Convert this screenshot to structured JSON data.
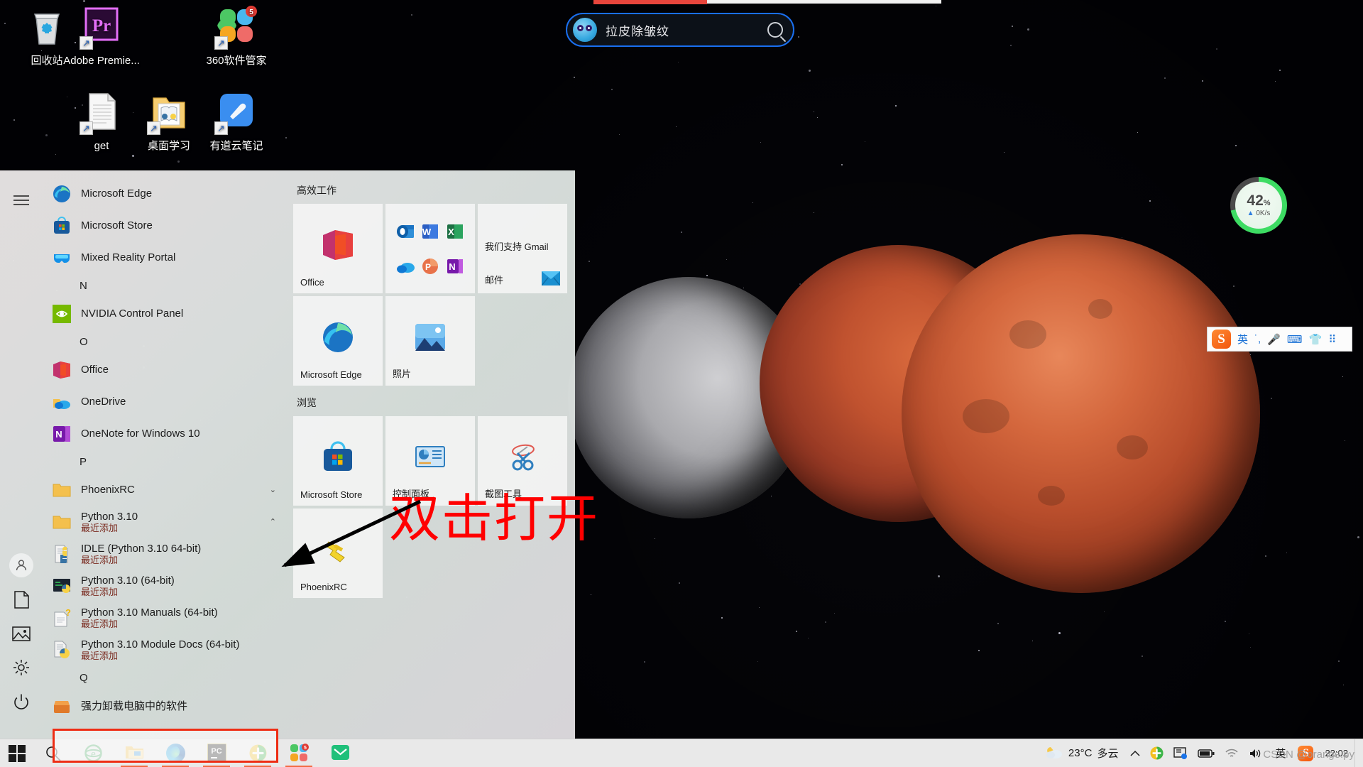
{
  "desktop": {
    "icons": [
      {
        "label": "回收站",
        "icon": "recycle-bin-icon",
        "shortcut": false
      },
      {
        "label": "Adobe Premie...",
        "icon": "adobe-premiere-icon",
        "shortcut": true
      },
      {
        "label": "360软件管家",
        "icon": "360-software-manager-icon",
        "shortcut": true,
        "badge": "5"
      },
      {
        "label": "get",
        "icon": "text-document-icon",
        "shortcut": true
      },
      {
        "label": "桌面学习",
        "icon": "folder-study-icon",
        "shortcut": true
      },
      {
        "label": "有道云笔记",
        "icon": "youdao-cloud-note-icon",
        "shortcut": true
      }
    ]
  },
  "search_overlay": {
    "value": "拉皮除皱纹",
    "icon": "bird-mascot-icon",
    "search_icon": "search-icon"
  },
  "perf_gauge": {
    "percent": "42",
    "percent_unit": "%",
    "network": "0K/s",
    "arrow": "▲",
    "accent": "#3ddc63"
  },
  "sogou_bar": {
    "logo": "S",
    "items": [
      "英",
      "·,",
      "mic-icon",
      "keyboard-icon",
      "skin-icon",
      "apps-icon"
    ]
  },
  "start_menu": {
    "rail": [
      {
        "name": "hamburger-icon",
        "label": "☰"
      },
      {
        "name": "user-account-icon",
        "label": ""
      },
      {
        "name": "documents-icon",
        "label": ""
      },
      {
        "name": "pictures-icon",
        "label": ""
      },
      {
        "name": "settings-gear-icon",
        "label": ""
      },
      {
        "name": "power-icon",
        "label": ""
      }
    ],
    "apps": [
      {
        "type": "app",
        "label": "Microsoft Edge",
        "icon": "edge-icon"
      },
      {
        "type": "app",
        "label": "Microsoft Store",
        "icon": "store-icon"
      },
      {
        "type": "app",
        "label": "Mixed Reality Portal",
        "icon": "mixed-reality-icon"
      },
      {
        "type": "letter",
        "label": "N"
      },
      {
        "type": "app",
        "label": "NVIDIA Control Panel",
        "icon": "nvidia-icon"
      },
      {
        "type": "letter",
        "label": "O"
      },
      {
        "type": "app",
        "label": "Office",
        "icon": "office-icon"
      },
      {
        "type": "app",
        "label": "OneDrive",
        "icon": "onedrive-icon"
      },
      {
        "type": "app",
        "label": "OneNote for Windows 10",
        "icon": "onenote-icon"
      },
      {
        "type": "letter",
        "label": "P"
      },
      {
        "type": "folder",
        "label": "PhoenixRC",
        "icon": "folder-icon",
        "chevron": "⌄"
      },
      {
        "type": "folder",
        "label": "Python 3.10",
        "sub": "最近添加",
        "icon": "folder-icon",
        "chevron": "⌃"
      },
      {
        "type": "app",
        "label": "IDLE (Python 3.10 64-bit)",
        "sub": "最近添加",
        "icon": "python-idle-icon",
        "highlighted": true
      },
      {
        "type": "app",
        "label": "Python 3.10 (64-bit)",
        "sub": "最近添加",
        "icon": "python-console-icon"
      },
      {
        "type": "app",
        "label": "Python 3.10 Manuals (64-bit)",
        "sub": "最近添加",
        "icon": "python-manuals-icon"
      },
      {
        "type": "app",
        "label": "Python 3.10 Module Docs (64-bit)",
        "sub": "最近添加",
        "icon": "python-moduledocs-icon"
      },
      {
        "type": "letter",
        "label": "Q"
      },
      {
        "type": "app",
        "label": "强力卸载电脑中的软件",
        "icon": "uninstall-tool-icon"
      }
    ],
    "tile_groups": [
      {
        "title": "高效工作",
        "tiles": [
          {
            "label": "Office",
            "icon": "office-icon",
            "kind": "single"
          },
          {
            "label": "",
            "kind": "grid6",
            "minis": [
              "outlook-icon",
              "word-icon",
              "excel-icon",
              "onedrive-icon",
              "powerpoint-icon",
              "onenote-icon"
            ]
          },
          {
            "label": "邮件",
            "kind": "mail",
            "headline": "我们支持 Gmail",
            "icon": "mail-icon"
          },
          {
            "label": "Microsoft Edge",
            "icon": "edge-icon",
            "kind": "single"
          },
          {
            "label": "照片",
            "icon": "photos-icon",
            "kind": "single"
          }
        ]
      },
      {
        "title": "浏览",
        "tiles": [
          {
            "label": "Microsoft Store",
            "icon": "store-icon",
            "kind": "single"
          },
          {
            "label": "控制面板",
            "icon": "control-panel-icon",
            "kind": "single"
          },
          {
            "label": "截图工具",
            "icon": "snipping-tool-icon",
            "kind": "single"
          },
          {
            "label": "PhoenixRC",
            "icon": "phoenixrc-icon",
            "kind": "single"
          }
        ]
      }
    ]
  },
  "annotation": {
    "text": "双击打开",
    "color": "#ff0000",
    "arrow": "arrow-pointing-down-left"
  },
  "taskbar": {
    "start": "start-button",
    "pinned": [
      {
        "name": "search-icon",
        "running": false
      },
      {
        "name": "internet-explorer-icon",
        "running": false
      },
      {
        "name": "file-explorer-icon",
        "running": true
      },
      {
        "name": "microsoft-edge-icon",
        "running": true
      },
      {
        "name": "pycharm-icon",
        "running": true,
        "label": "PC"
      },
      {
        "name": "360-security-icon",
        "running": true
      },
      {
        "name": "360-software-manager-icon",
        "running": true,
        "badge": "5"
      },
      {
        "name": "mail-app-icon",
        "running": false
      }
    ],
    "tray": {
      "weather_temp": "23°C",
      "weather_desc": "多云",
      "chevron": "⌃",
      "icons": [
        "360-tray-icon",
        "screenshot-tray-icon",
        "battery-icon",
        "wifi-icon",
        "volume-icon"
      ],
      "ime": "英",
      "sogou": "S",
      "clock_time": "22:02",
      "watermark": "CSDN @orange.py"
    }
  }
}
